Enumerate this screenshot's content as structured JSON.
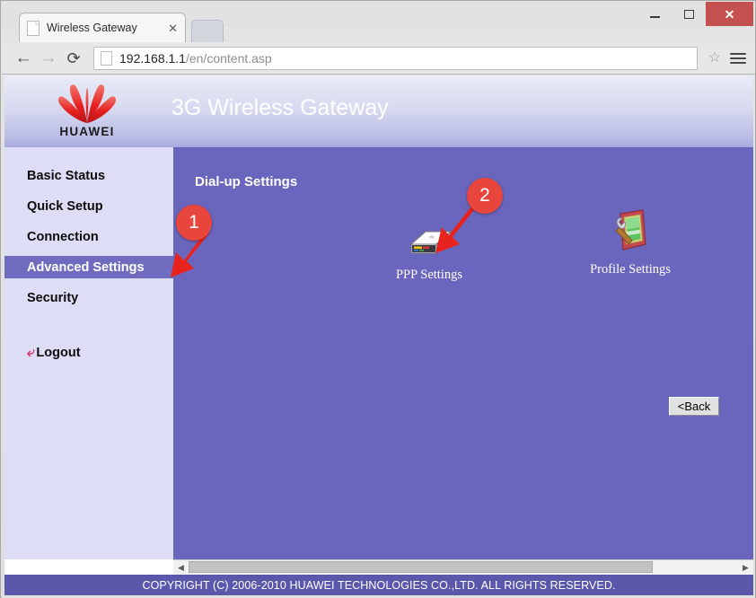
{
  "window": {
    "minimize_label": "—",
    "maximize_label": "□",
    "close_label": "✕"
  },
  "browser": {
    "tab": {
      "title": "Wireless Gateway",
      "close_label": "✕",
      "favicon": "page-icon"
    },
    "new_tab_label": "",
    "toolbar": {
      "back_label": "←",
      "forward_label": "→",
      "reload_label": "⟳",
      "bookmark_label": "☆",
      "menu_label": "menu-icon"
    },
    "omnibox": {
      "host": "192.168.1.1",
      "path": "/en/content.asp",
      "icon": "page-icon"
    }
  },
  "page": {
    "header": {
      "brand": "HUAWEI",
      "title": "3G Wireless Gateway",
      "logo_color": "#e8201f"
    },
    "sidebar": {
      "items": [
        {
          "label": "Basic Status",
          "active": false
        },
        {
          "label": "Quick Setup",
          "active": false
        },
        {
          "label": "Connection",
          "active": false
        },
        {
          "label": "Advanced Settings",
          "active": true
        },
        {
          "label": "Security",
          "active": false
        }
      ],
      "logout": {
        "label": "Logout",
        "icon": "return-arrow-icon"
      },
      "active_bg": "#6f6cc0",
      "bg": "#dddef5"
    },
    "main": {
      "title": "Dial-up Settings",
      "bg": "#6a66be",
      "tiles": [
        {
          "label": "PPP Settings",
          "icon": "modem-device-icon"
        },
        {
          "label": "Profile Settings",
          "icon": "screen-wrench-icon"
        }
      ],
      "back_button": "<Back"
    },
    "scrollbar": {
      "left_arrow": "◀",
      "right_arrow": "▶",
      "thumb_percent": 85
    },
    "footer": {
      "copyright": "COPYRIGHT (C) 2006-2010 HUAWEI TECHNOLOGIES CO.,LTD. ALL RIGHTS RESERVED."
    }
  },
  "annotations": {
    "markers": [
      {
        "number": "1",
        "points_to": "Advanced Settings"
      },
      {
        "number": "2",
        "points_to": "PPP Settings"
      }
    ],
    "color": "#e8463c"
  }
}
